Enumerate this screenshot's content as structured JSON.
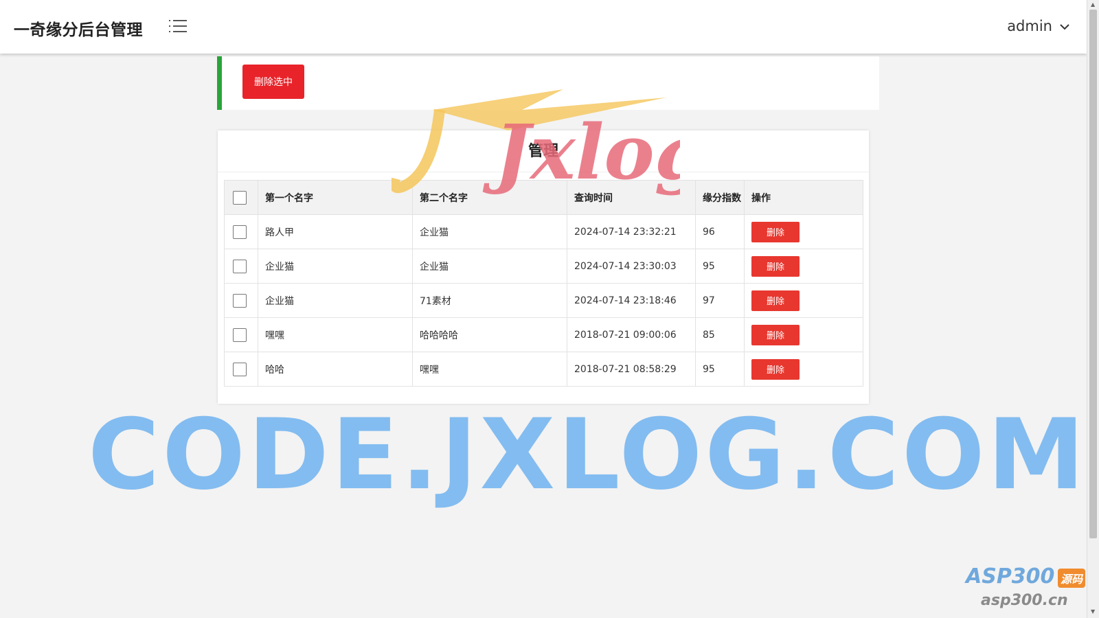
{
  "header": {
    "app_title": "一奇缘分后台管理",
    "user_name": "admin",
    "icons": {
      "menu": "list-menu-icon",
      "dropdown": "chevron-down-icon"
    }
  },
  "toolbar": {
    "delete_selected_label": "删除选中"
  },
  "panel": {
    "title": "管理"
  },
  "table": {
    "headers": [
      "第一个名字",
      "第二个名字",
      "查询时间",
      "缘分指数",
      "操作"
    ],
    "rows": [
      {
        "first_name": "路人甲",
        "second_name": "企业猫",
        "query_time": "2024-07-14 23:32:21",
        "score": "96",
        "action": "删除"
      },
      {
        "first_name": "企业猫",
        "second_name": "企业猫",
        "query_time": "2024-07-14 23:30:03",
        "score": "95",
        "action": "删除"
      },
      {
        "first_name": "企业猫",
        "second_name": "71素材",
        "query_time": "2024-07-14 23:18:46",
        "score": "97",
        "action": "删除"
      },
      {
        "first_name": "嘿嘿",
        "second_name": "哈哈哈哈",
        "query_time": "2018-07-21 09:00:06",
        "score": "85",
        "action": "删除"
      },
      {
        "first_name": "哈哈",
        "second_name": "嘿嘿",
        "query_time": "2018-07-21 08:58:29",
        "score": "95",
        "action": "删除"
      }
    ]
  },
  "watermarks": {
    "jxlog": "Jxlog",
    "code_site": "CODE.JXLOG.COM",
    "asp_brand": "ASP300",
    "asp_tag": "源码",
    "asp_url": "asp300.cn"
  },
  "colors": {
    "accent_green": "#2aa43a",
    "danger_red": "#e8232a",
    "watermark_blue": "#7ab8f0"
  }
}
